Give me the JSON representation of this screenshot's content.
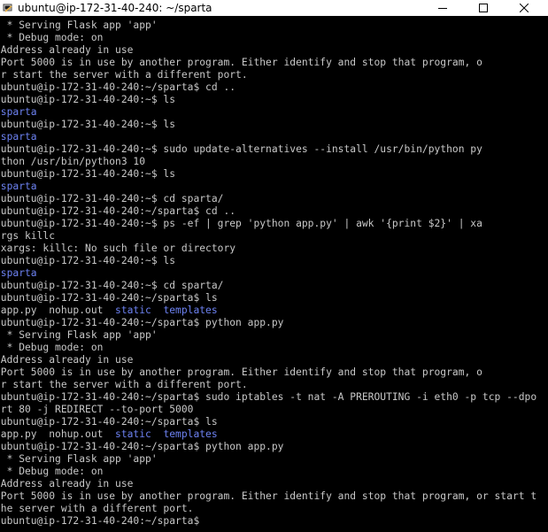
{
  "window": {
    "title": "ubuntu@ip-172-31-40-240: ~/sparta",
    "icon": "putty-terminal-icon",
    "controls": [
      "minimize-icon",
      "maximize-icon",
      "close-icon"
    ]
  },
  "colors": {
    "background": "#000000",
    "text": "#c8c8c8",
    "directory": "#6d82f2"
  },
  "terminal": {
    "lines": [
      [
        {
          "t": "  * Serving Flask app 'app'"
        }
      ],
      [
        {
          "t": "  * Debug mode: on"
        }
      ],
      [
        {
          "t": " Address already in use"
        }
      ],
      [
        {
          "t": " Port 5000 is in use by another program. Either identify and stop that program, o"
        }
      ],
      [
        {
          "t": " r start the server with a different port."
        }
      ],
      [
        {
          "t": " ubuntu@ip-172-31-40-240:~/sparta$ cd .."
        }
      ],
      [
        {
          "t": " ubuntu@ip-172-31-40-240:~$ ls"
        }
      ],
      [
        {
          "t": " sparta",
          "c": "blue"
        }
      ],
      [
        {
          "t": " ubuntu@ip-172-31-40-240:~$ ls"
        }
      ],
      [
        {
          "t": " sparta",
          "c": "blue"
        }
      ],
      [
        {
          "t": " ubuntu@ip-172-31-40-240:~$ sudo update-alternatives --install /usr/bin/python py"
        }
      ],
      [
        {
          "t": " thon /usr/bin/python3 10"
        }
      ],
      [
        {
          "t": " ubuntu@ip-172-31-40-240:~$ ls"
        }
      ],
      [
        {
          "t": " sparta",
          "c": "blue"
        }
      ],
      [
        {
          "t": " ubuntu@ip-172-31-40-240:~$ cd sparta/"
        }
      ],
      [
        {
          "t": " ubuntu@ip-172-31-40-240:~/sparta$ cd .."
        }
      ],
      [
        {
          "t": " ubuntu@ip-172-31-40-240:~$ ps -ef | grep 'python app.py' | awk '{print $2}' | xa"
        }
      ],
      [
        {
          "t": " rgs killc"
        }
      ],
      [
        {
          "t": " xargs: killc: No such file or directory"
        }
      ],
      [
        {
          "t": " ubuntu@ip-172-31-40-240:~$ ls"
        }
      ],
      [
        {
          "t": " sparta",
          "c": "blue"
        }
      ],
      [
        {
          "t": " ubuntu@ip-172-31-40-240:~$ cd sparta/"
        }
      ],
      [
        {
          "t": " ubuntu@ip-172-31-40-240:~/sparta$ ls"
        }
      ],
      [
        {
          "t": " app.py  nohup.out  "
        },
        {
          "t": "static",
          "c": "blue"
        },
        {
          "t": "  "
        },
        {
          "t": "templates",
          "c": "blue"
        }
      ],
      [
        {
          "t": " ubuntu@ip-172-31-40-240:~/sparta$ python app.py"
        }
      ],
      [
        {
          "t": "  * Serving Flask app 'app'"
        }
      ],
      [
        {
          "t": "  * Debug mode: on"
        }
      ],
      [
        {
          "t": " Address already in use"
        }
      ],
      [
        {
          "t": " Port 5000 is in use by another program. Either identify and stop that program, o"
        }
      ],
      [
        {
          "t": " r start the server with a different port."
        }
      ],
      [
        {
          "t": " ubuntu@ip-172-31-40-240:~/sparta$ sudo iptables -t nat -A PREROUTING -i eth0 -p tcp --dpo"
        }
      ],
      [
        {
          "t": " rt 80 -j REDIRECT --to-port 5000"
        }
      ],
      [
        {
          "t": " ubuntu@ip-172-31-40-240:~/sparta$ ls"
        }
      ],
      [
        {
          "t": " app.py  nohup.out  "
        },
        {
          "t": "static",
          "c": "blue"
        },
        {
          "t": "  "
        },
        {
          "t": "templates",
          "c": "blue"
        }
      ],
      [
        {
          "t": " ubuntu@ip-172-31-40-240:~/sparta$ python app.py"
        }
      ],
      [
        {
          "t": "  * Serving Flask app 'app'"
        }
      ],
      [
        {
          "t": "  * Debug mode: on"
        }
      ],
      [
        {
          "t": " Address already in use"
        }
      ],
      [
        {
          "t": " Port 5000 is in use by another program. Either identify and stop that program, or start t"
        }
      ],
      [
        {
          "t": " he server with a different port."
        }
      ],
      [
        {
          "t": " ubuntu@ip-172-31-40-240:~/sparta$"
        }
      ]
    ]
  }
}
